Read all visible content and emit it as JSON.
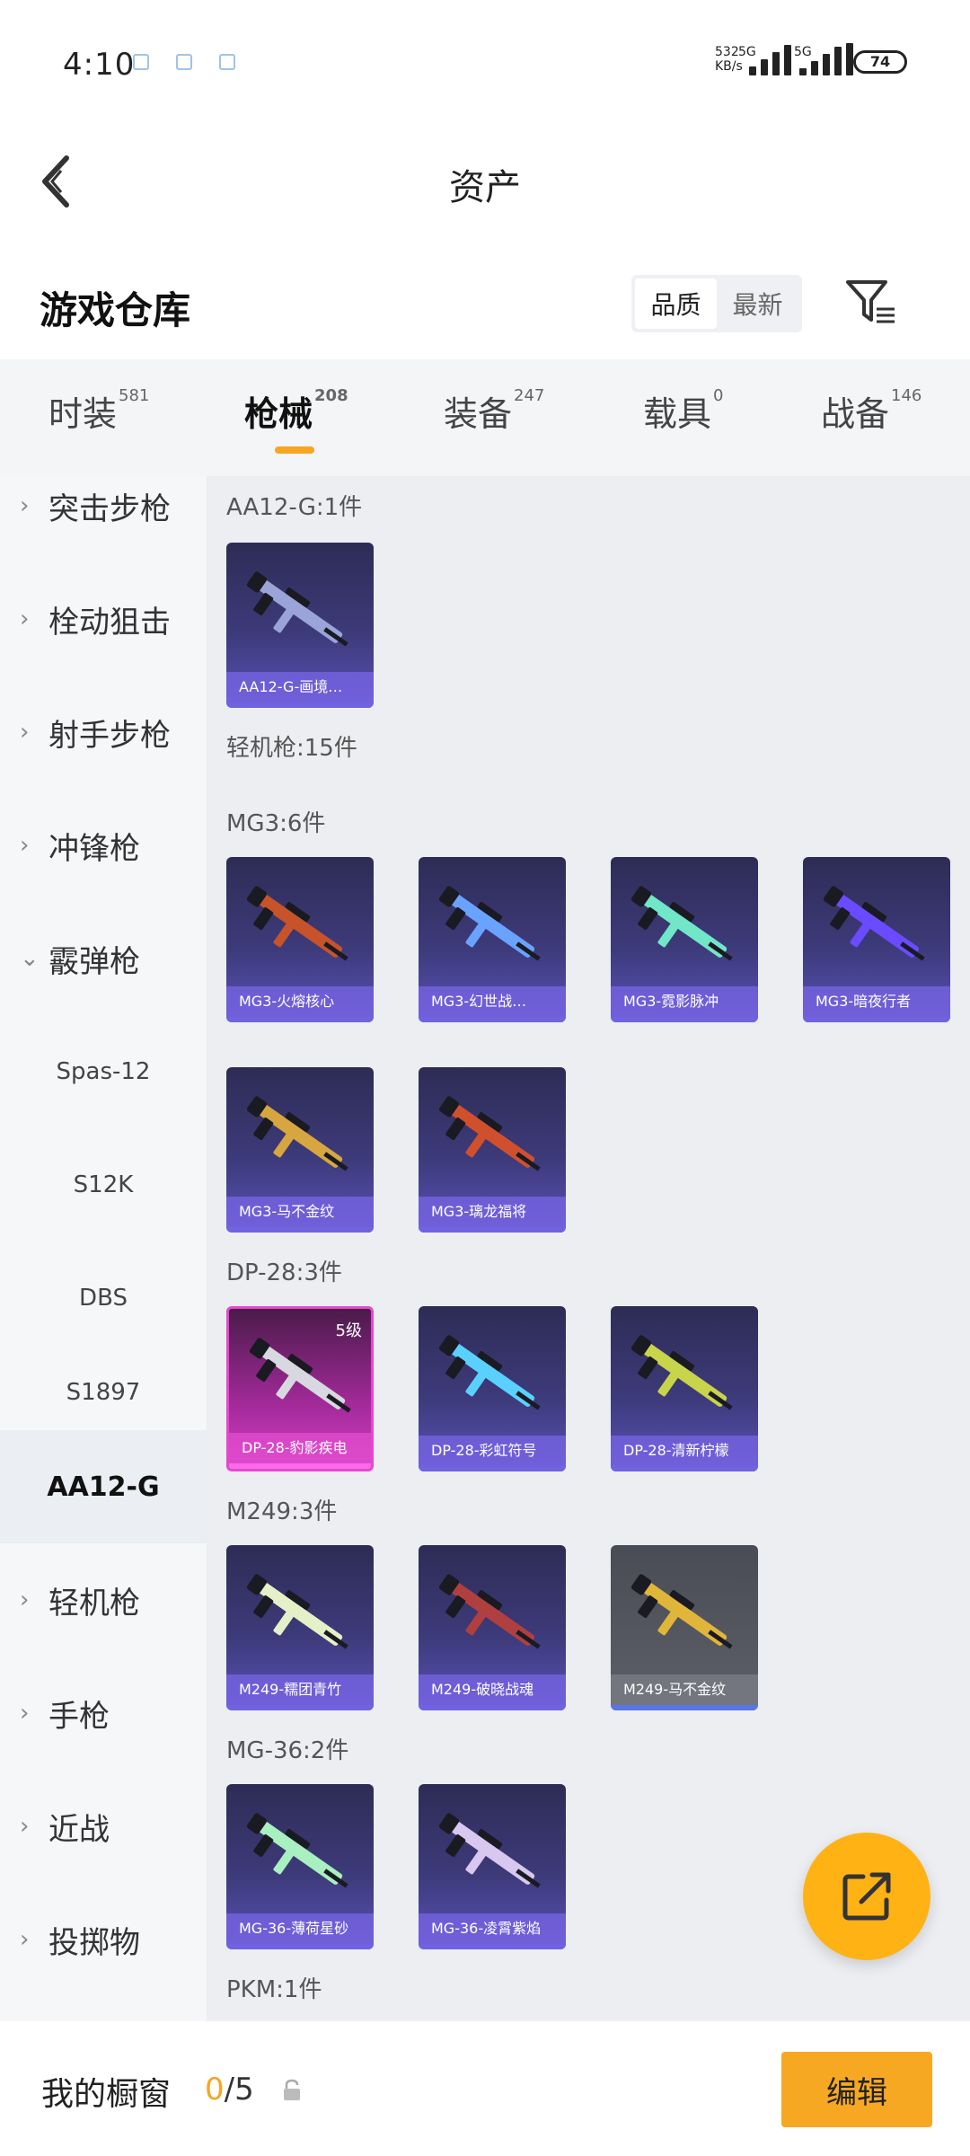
{
  "status_bar": {
    "time": "4:10",
    "net_speed_top": "532",
    "net_speed_bottom": "KB/s",
    "sim1": "5G",
    "sim2": "5G",
    "battery": "74"
  },
  "header": {
    "title": "资产"
  },
  "warehouse": {
    "title": "游戏仓库",
    "sort_options": [
      "品质",
      "最新"
    ],
    "active_sort": "品质"
  },
  "categories": [
    {
      "label": "时装",
      "count": "581"
    },
    {
      "label": "枪械",
      "count": "208",
      "active": true
    },
    {
      "label": "装备",
      "count": "247"
    },
    {
      "label": "载具",
      "count": "0"
    },
    {
      "label": "战备",
      "count": "146"
    }
  ],
  "sidebar": [
    {
      "label": "突击步枪",
      "type": "collapsed"
    },
    {
      "label": "栓动狙击",
      "type": "collapsed"
    },
    {
      "label": "射手步枪",
      "type": "collapsed"
    },
    {
      "label": "冲锋枪",
      "type": "collapsed"
    },
    {
      "label": "霰弹枪",
      "type": "expanded"
    },
    {
      "label": "Spas-12",
      "type": "sub"
    },
    {
      "label": "S12K",
      "type": "sub"
    },
    {
      "label": "DBS",
      "type": "sub"
    },
    {
      "label": "S1897",
      "type": "sub"
    },
    {
      "label": "AA12-G",
      "type": "selected"
    },
    {
      "label": "轻机枪",
      "type": "collapsed"
    },
    {
      "label": "手枪",
      "type": "collapsed"
    },
    {
      "label": "近战",
      "type": "collapsed"
    },
    {
      "label": "投掷物",
      "type": "collapsed"
    }
  ],
  "content": {
    "sections": [
      {
        "label": "AA12-G:1件"
      },
      {
        "label": "轻机枪:15件"
      },
      {
        "label": "MG3:6件"
      },
      {
        "label": "DP-28:3件"
      },
      {
        "label": "M249:3件"
      },
      {
        "label": "MG-36:2件"
      },
      {
        "label": "PKM:1件"
      }
    ],
    "items": [
      {
        "name": "AA12-G-画境…",
        "style": "purple",
        "gun_color": "#9aa4d8"
      },
      {
        "name": "MG3-火熔核心",
        "style": "purple",
        "gun_color": "#c6532a"
      },
      {
        "name": "MG3-幻世战…",
        "style": "purple",
        "gun_color": "#6aa2ff"
      },
      {
        "name": "MG3-霓影脉冲",
        "style": "purple",
        "gun_color": "#72e6c8"
      },
      {
        "name": "MG3-暗夜行者",
        "style": "purple",
        "gun_color": "#6b4bff"
      },
      {
        "name": "MG3-马不金纹",
        "style": "purple",
        "gun_color": "#d8a640"
      },
      {
        "name": "MG3-璃龙福将",
        "style": "purple",
        "gun_color": "#d0502e"
      },
      {
        "name": "DP-28-豹影疾电",
        "style": "pink",
        "gun_color": "#d8d8e0",
        "badge": "5级"
      },
      {
        "name": "DP-28-彩虹符号",
        "style": "purple",
        "gun_color": "#5ad0ff"
      },
      {
        "name": "DP-28-清新柠檬",
        "style": "purple",
        "gun_color": "#c8d44a"
      },
      {
        "name": "M249-糯团青竹",
        "style": "purple",
        "gun_color": "#e6f0c8"
      },
      {
        "name": "M249-破晓战魂",
        "style": "purple",
        "gun_color": "#b04040"
      },
      {
        "name": "M249-马不金纹",
        "style": "gray",
        "gun_color": "#e0b63a"
      },
      {
        "name": "MG-36-薄荷星砂",
        "style": "purple",
        "gun_color": "#a8f0c0"
      },
      {
        "name": "MG-36-凌霄紫焰",
        "style": "purple",
        "gun_color": "#d8c8f0"
      }
    ]
  },
  "bottom_bar": {
    "title": "我的橱窗",
    "count_current": "0",
    "count_total": "/5",
    "edit_label": "编辑"
  },
  "colors": {
    "accent": "#f5a623",
    "fab": "#ffb214",
    "card_purple": "#3d3a7a",
    "card_pink": "#d43fc2"
  }
}
